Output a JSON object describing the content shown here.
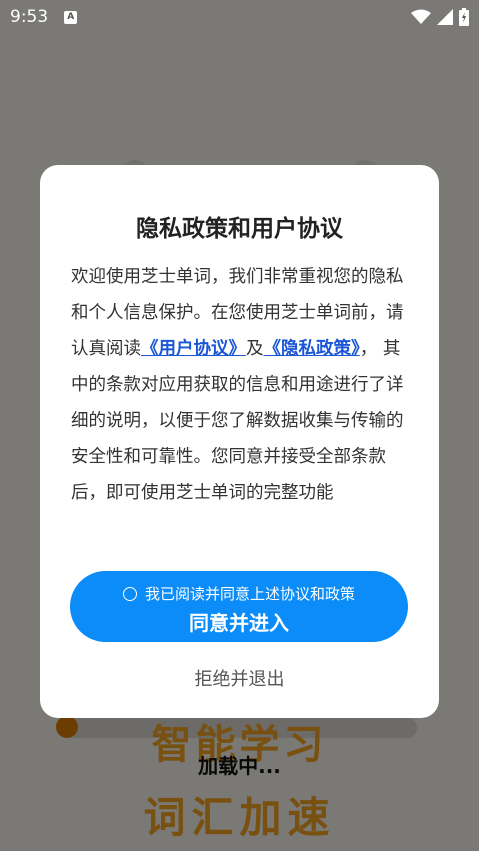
{
  "status_bar": {
    "time": "9:53",
    "notification_badge": "A",
    "icons": [
      "wifi-icon",
      "signal-icon",
      "battery-icon"
    ]
  },
  "background": {
    "loading_text": "加载中...",
    "splash_line1": "智能学习",
    "splash_line2": "词汇加速",
    "accent_color": "#f0a020"
  },
  "dialog": {
    "title": "隐私政策和用户协议",
    "body_part1": "欢迎使用芝士单词，我们非常重视您的隐私和个人信息保护。在您使用芝士单词前，请认真阅读",
    "link_user_agreement": "《用户协议》",
    "body_and": "及",
    "link_privacy_policy": "《隐私政策》",
    "body_part2": "， 其中的条款对应用获取的信息和用途进行了详细的说明，以便于您了解数据收集与传输的安全性和可靠性。您同意并接受全部条款后，即可使用芝士单词的完整功能",
    "checkbox_label": "我已阅读并同意上述协议和政策",
    "agree_button": "同意并进入",
    "reject_button": "拒绝并退出",
    "primary_color": "#0b8cf8",
    "link_color": "#1a56d6"
  }
}
